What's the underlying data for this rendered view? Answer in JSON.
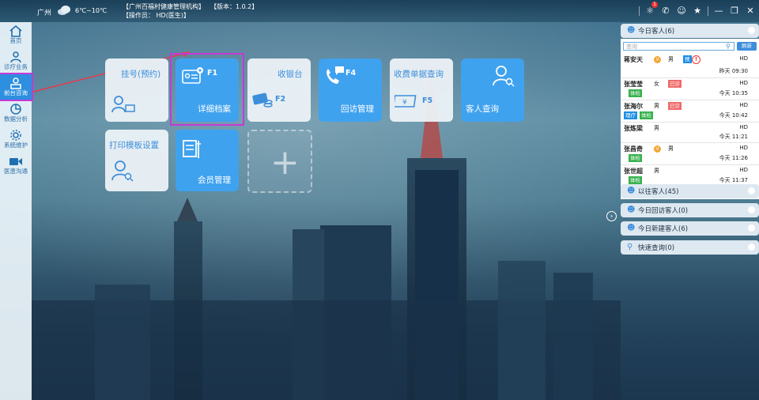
{
  "header": {
    "city": "广州",
    "temperature": "6℃~10℃",
    "org_line": "【广州百福村健康管理机构】",
    "operator_line": "【操作员： HD(医生)】",
    "version": "【版本：1.0.2】",
    "badge_count": "1"
  },
  "sidebar": {
    "items": [
      {
        "label": "首页",
        "icon": "home-icon"
      },
      {
        "label": "诊疗业务",
        "icon": "user-group-icon"
      },
      {
        "label": "前台咨询",
        "icon": "reception-icon"
      },
      {
        "label": "数据分析",
        "icon": "chart-icon"
      },
      {
        "label": "系统维护",
        "icon": "gear-icon"
      },
      {
        "label": "医患沟通",
        "icon": "video-icon"
      }
    ]
  },
  "tiles": {
    "register": {
      "label": "挂号(预约)"
    },
    "detail": {
      "label": "详细档案",
      "key": "F1"
    },
    "cashier": {
      "label": "收银台",
      "key": "F2"
    },
    "followup": {
      "label": "回访管理",
      "key": "F4"
    },
    "receipt": {
      "label": "收费单据查询",
      "key": "F5"
    },
    "guest_query": {
      "label": "客人查询"
    },
    "print_template": {
      "label": "打印模板设置"
    },
    "member": {
      "label": "会员管理"
    }
  },
  "panel": {
    "today_guests": "今日客人(6)",
    "search_placeholder": "查询",
    "refresh": "刷新",
    "past_guests": "以往客人(45)",
    "today_followup": "今日回访客人(0)",
    "today_new": "今日新建客人(6)",
    "quick_query": "快速查询(0)",
    "guests": [
      {
        "name": "蒋安天",
        "sex": "男",
        "doctor": "HD",
        "time": "昨天 09:30",
        "tags": []
      },
      {
        "name": "张莹莹",
        "sex": "女",
        "doctor": "HD",
        "time": "今天 10:35",
        "status": "已诊",
        "tags": [
          "体检"
        ]
      },
      {
        "name": "张海尔",
        "sex": "男",
        "doctor": "HD",
        "time": "今天 10:42",
        "status": "已诊",
        "tags": [
          "理疗",
          "体检"
        ]
      },
      {
        "name": "张炼梁",
        "sex": "男",
        "doctor": "HD",
        "time": "今天 11:21",
        "tags": []
      },
      {
        "name": "张昌奇",
        "sex": "男",
        "doctor": "HD",
        "time": "今天 11:26",
        "tags": [
          "体检"
        ]
      },
      {
        "name": "张世超",
        "sex": "男",
        "doctor": "HD",
        "time": "今天 11:37",
        "tags": [
          "体检"
        ]
      }
    ]
  },
  "colors": {
    "accent": "#3fa2ef",
    "highlight": "#c43ad6",
    "status_red": "#f06a6a",
    "tag_green": "#37b24d"
  }
}
